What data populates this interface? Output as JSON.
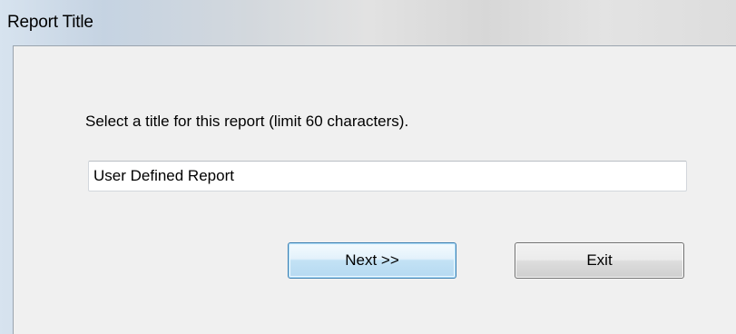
{
  "window": {
    "title": "Report Title"
  },
  "dialog": {
    "prompt": "Select a title for this report (limit 60 characters).",
    "title_input_value": "User Defined Report",
    "next_label": "Next >>",
    "exit_label": "Exit"
  },
  "colors": {
    "client_background": "#f0f0f0",
    "default_button_border": "#3c7fb1",
    "button_border": "#707070"
  }
}
